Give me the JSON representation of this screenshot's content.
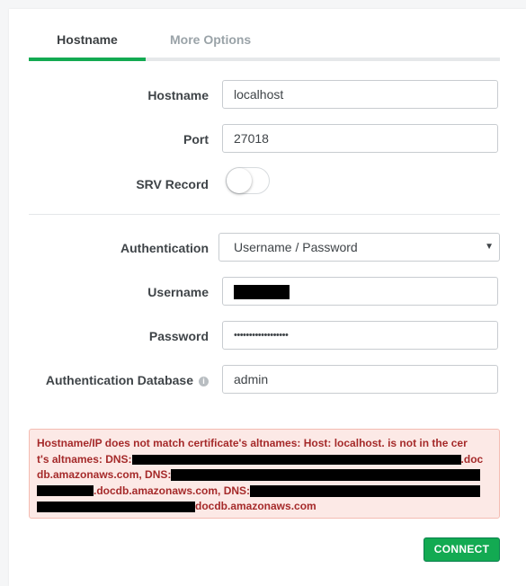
{
  "tabs": [
    {
      "label": "Hostname",
      "active": true
    },
    {
      "label": "More Options",
      "active": false
    }
  ],
  "hostname": {
    "label": "Hostname",
    "value": "localhost"
  },
  "port": {
    "label": "Port",
    "value": "27018"
  },
  "srv": {
    "label": "SRV Record",
    "enabled": false
  },
  "authentication": {
    "label": "Authentication",
    "selected": "Username / Password"
  },
  "username": {
    "label": "Username",
    "value": ""
  },
  "password": {
    "label": "Password",
    "value": "••••••••••••••••••"
  },
  "auth_db": {
    "label": "Authentication Database",
    "value": "admin",
    "icon": "info-icon"
  },
  "error": {
    "line1": "Hostname/IP does not match certificate's altnames: Host: localhost. is not in the cer",
    "line2_prefix": "t's altnames: DNS:",
    "line2_suffix": ".doc",
    "line3_prefix": "db.amazonaws.com, DNS:",
    "line4_mid": ".docdb.amazonaws.com, DNS:",
    "line5_suffix": "docdb.amazonaws.com"
  },
  "connect_label": "CONNECT",
  "colors": {
    "accent": "#13aa52",
    "error_bg": "#fce9e6",
    "error_text": "#a52a2a"
  }
}
